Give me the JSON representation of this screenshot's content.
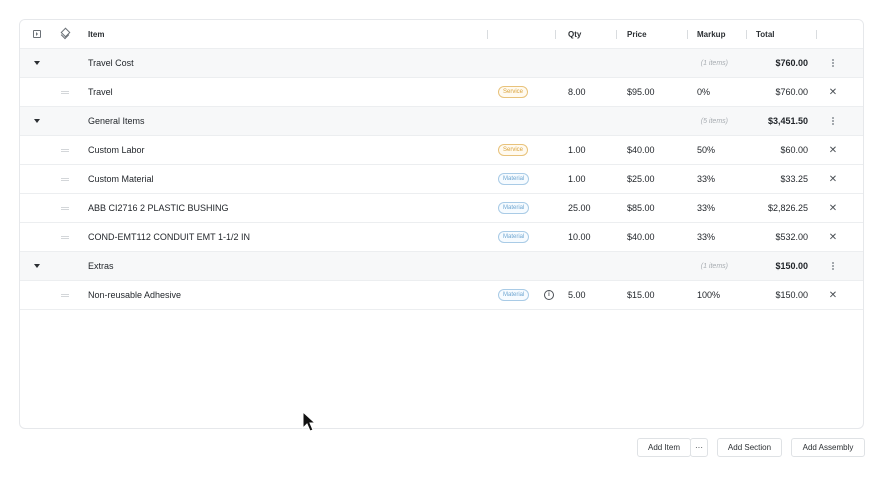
{
  "header": {
    "item": "Item",
    "qty": "Qty",
    "price": "Price",
    "markup": "Markup",
    "total": "Total"
  },
  "sections": [
    {
      "name": "Travel Cost",
      "count": "(1 items)",
      "total": "$760.00",
      "rows": [
        {
          "item": "Travel",
          "badge": "Service",
          "badge_type": "service",
          "info": false,
          "qty": "8.00",
          "price": "$95.00",
          "markup": "0%",
          "total": "$760.00"
        }
      ]
    },
    {
      "name": "General Items",
      "count": "(5 items)",
      "total": "$3,451.50",
      "rows": [
        {
          "item": "Custom Labor",
          "badge": "Service",
          "badge_type": "service",
          "info": false,
          "qty": "1.00",
          "price": "$40.00",
          "markup": "50%",
          "total": "$60.00"
        },
        {
          "item": "Custom Material",
          "badge": "Material",
          "badge_type": "material",
          "info": false,
          "qty": "1.00",
          "price": "$25.00",
          "markup": "33%",
          "total": "$33.25"
        },
        {
          "item": "ABB CI2716 2 PLASTIC BUSHING",
          "badge": "Material",
          "badge_type": "material",
          "info": false,
          "qty": "25.00",
          "price": "$85.00",
          "markup": "33%",
          "total": "$2,826.25"
        },
        {
          "item": "COND-EMT112 CONDUIT EMT 1-1/2 IN",
          "badge": "Material",
          "badge_type": "material",
          "info": false,
          "qty": "10.00",
          "price": "$40.00",
          "markup": "33%",
          "total": "$532.00"
        }
      ]
    },
    {
      "name": "Extras",
      "count": "(1 items)",
      "total": "$150.00",
      "rows": [
        {
          "item": "Non-reusable Adhesive",
          "badge": "Material",
          "badge_type": "material",
          "info": true,
          "qty": "5.00",
          "price": "$15.00",
          "markup": "100%",
          "total": "$150.00"
        }
      ]
    }
  ],
  "icons": {
    "expand": "expand-box-icon",
    "layers": "layers-icon",
    "caret": "caret-down-icon",
    "drag": "drag-handle-icon",
    "kebab": "kebab-menu-icon",
    "remove": "close-icon",
    "info": "info-icon"
  },
  "footer": {
    "add_item": "Add Item",
    "more": "···",
    "add_section": "Add Section",
    "add_assembly": "Add Assembly"
  }
}
